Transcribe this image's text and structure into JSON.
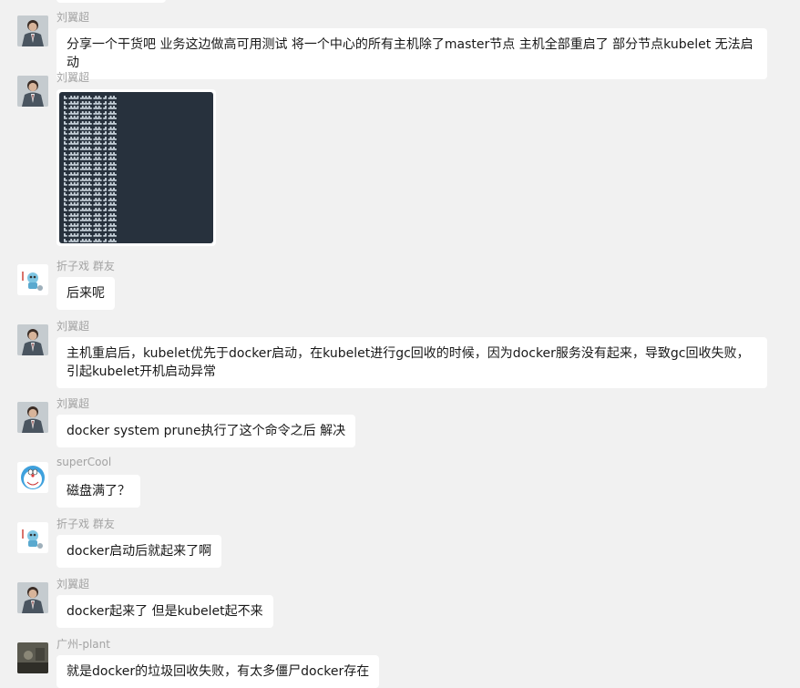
{
  "colors": {
    "background": "#f1f1f1",
    "bubble": "#ffffff",
    "sender_name": "#a3a3a3",
    "message_text": "#191919",
    "terminal_bg": "#27313d"
  },
  "messages": [
    {
      "sender": "刘翼超",
      "avatar": "man-in-suit-avatar",
      "type": "text",
      "text": "分享一个干货吧  业务这边做高可用测试 将一个中心的所有主机除了master节点 主机全部重启了 部分节点kubelet 无法启动"
    },
    {
      "sender": "刘翼超",
      "avatar": "man-in-suit-avatar",
      "type": "image",
      "image": "terminal-screenshot-kubectl-get-nodes"
    },
    {
      "sender": "折子戏 群友",
      "avatar": "cartoon-robot-avatar",
      "type": "text",
      "text": "后来呢"
    },
    {
      "sender": "刘翼超",
      "avatar": "man-in-suit-avatar",
      "type": "text",
      "text": "主机重启后，kubelet优先于docker启动，在kubelet进行gc回收的时候，因为docker服务没有起来，导致gc回收失败，引起kubelet开机启动异常"
    },
    {
      "sender": "刘翼超",
      "avatar": "man-in-suit-avatar",
      "type": "text",
      "text": "docker system prune执行了这个命令之后 解决"
    },
    {
      "sender": "superCool",
      "avatar": "doraemon-avatar",
      "type": "text",
      "text": "磁盘满了？"
    },
    {
      "sender": "折子戏 群友",
      "avatar": "cartoon-robot-avatar",
      "type": "text",
      "text": "docker启动后就起来了啊"
    },
    {
      "sender": "刘翼超",
      "avatar": "man-in-suit-avatar",
      "type": "text",
      "text": "docker起来了 但是kubelet起不来"
    },
    {
      "sender": "广州-plant",
      "avatar": "dark-photo-avatar",
      "type": "text",
      "text": "就是docker的垃圾回收失败，有太多僵尸docker存在"
    }
  ]
}
